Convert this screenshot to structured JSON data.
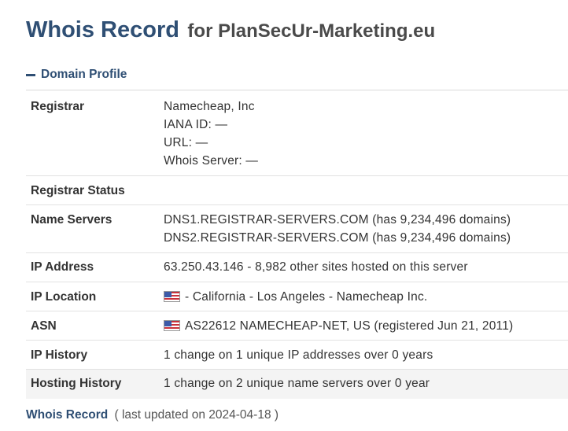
{
  "header": {
    "title": "Whois Record",
    "subtitle": "for PlanSecUr-Marketing.eu"
  },
  "section": {
    "title": "Domain Profile",
    "icon": "minus-icon"
  },
  "profile": {
    "registrar": {
      "label": "Registrar",
      "name": "Namecheap, Inc",
      "iana": "IANA ID: —",
      "url": "URL: —",
      "whois_server": "Whois Server: —"
    },
    "registrar_status": {
      "label": "Registrar Status",
      "value": ""
    },
    "name_servers": {
      "label": "Name Servers",
      "values": [
        "DNS1.REGISTRAR-SERVERS.COM (has 9,234,496 domains)",
        "DNS2.REGISTRAR-SERVERS.COM (has 9,234,496 domains)"
      ]
    },
    "ip_address": {
      "label": "IP Address",
      "value": "63.250.43.146 - 8,982 other sites hosted on this server"
    },
    "ip_location": {
      "label": "IP Location",
      "value": "- California - Los Angeles - Namecheap Inc.",
      "flag": "us-flag-icon"
    },
    "asn": {
      "label": "ASN",
      "value": "AS22612 NAMECHEAP-NET, US (registered Jun 21, 2011)",
      "flag": "us-flag-icon"
    },
    "ip_history": {
      "label": "IP History",
      "value": "1 change on 1 unique IP addresses over 0 years"
    },
    "hosting_history": {
      "label": "Hosting History",
      "value": "1 change on 2 unique name servers over 0 year"
    }
  },
  "footer": {
    "link": "Whois Record",
    "updated": "( last updated on 2024-04-18 )"
  }
}
